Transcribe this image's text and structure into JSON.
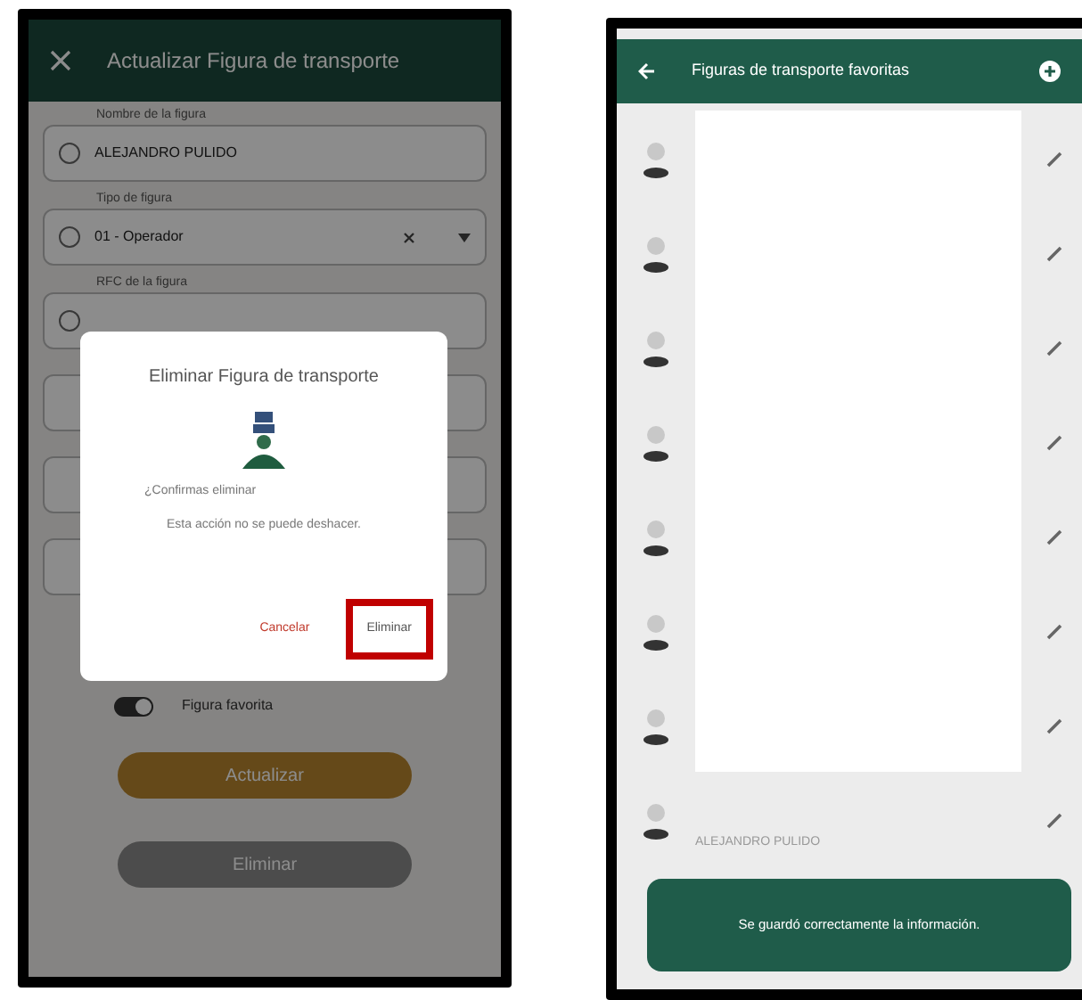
{
  "left_screen": {
    "header": {
      "title": "Actualizar Figura de transporte"
    },
    "fields": [
      {
        "label": "Nombre de la figura",
        "value": "ALEJANDRO PULIDO",
        "kind": "text"
      },
      {
        "label": "Tipo de figura",
        "value": "01 - Operador",
        "kind": "select"
      },
      {
        "label": "RFC de la figura",
        "kind": "text"
      }
    ],
    "toggle": {
      "label": "Figura favorita",
      "on": true
    },
    "buttons": [
      {
        "label": "Actualizar",
        "kind": "primary"
      },
      {
        "label": "Eliminar",
        "kind": "secondary"
      }
    ],
    "dialog": {
      "title": "Eliminar Figura de transporte",
      "question": "¿Confirmas eliminar",
      "warning": "Esta acción no se puede deshacer.",
      "buttons": [
        {
          "label": "Cancelar",
          "kind": "cancel",
          "highlighted": false
        },
        {
          "label": "Eliminar",
          "kind": "confirm",
          "highlighted": true
        }
      ]
    }
  },
  "right_screen": {
    "header": {
      "title": "Figuras de transporte favoritas"
    },
    "rows": [
      {
        "redacted": true
      },
      {
        "redacted": true
      },
      {
        "redacted": true
      },
      {
        "redacted": true
      },
      {
        "redacted": true
      },
      {
        "redacted": true
      },
      {
        "redacted": true
      },
      {
        "redacted": false,
        "name": "ALEJANDRO PULIDO"
      }
    ],
    "toast": {
      "text": "Se guardó correctamente la información."
    }
  }
}
